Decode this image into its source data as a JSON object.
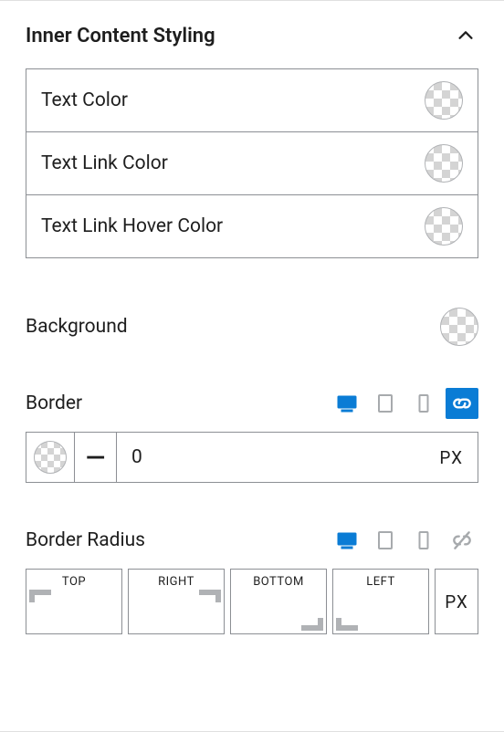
{
  "panel": {
    "title": "Inner Content Styling"
  },
  "colors": {
    "items": [
      {
        "label": "Text Color"
      },
      {
        "label": "Text Link Color"
      },
      {
        "label": "Text Link Hover Color"
      }
    ]
  },
  "background": {
    "label": "Background"
  },
  "border": {
    "label": "Border",
    "value": "0",
    "unit": "PX",
    "style_glyph": "—",
    "linked": true,
    "active_device": "desktop"
  },
  "border_radius": {
    "label": "Border Radius",
    "sides": [
      "TOP",
      "RIGHT",
      "BOTTOM",
      "LEFT"
    ],
    "unit": "PX",
    "linked": false,
    "active_device": "desktop"
  }
}
